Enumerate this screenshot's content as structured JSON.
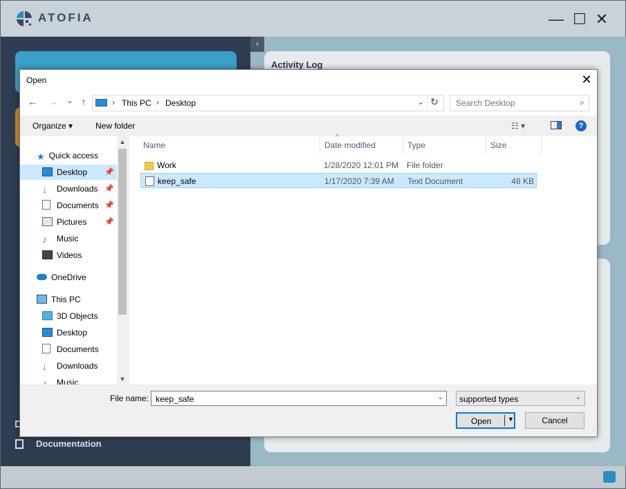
{
  "app": {
    "brand": "ATOFIA",
    "minimize": "—",
    "maximize": "☐",
    "close": "✕",
    "collapse": "‹",
    "activity_title": "Activity Log",
    "documentation_label": "Documentation"
  },
  "dialog": {
    "title": "Open",
    "close": "✕",
    "nav": {
      "back": "←",
      "forward": "→",
      "recent": "⌄",
      "up": "↑"
    },
    "address": {
      "crumbs": [
        "This PC",
        "Desktop"
      ],
      "separator": "›",
      "dropdown": "⌄",
      "refresh": "↻"
    },
    "search_placeholder": "Search Desktop",
    "search_icon": "⌕",
    "toolbar": {
      "organize": "Organize ▾",
      "new_folder": "New folder",
      "view": "☷ ▾",
      "help": "?"
    },
    "nav_pane": {
      "quick_access": "Quick access",
      "quick_items": [
        {
          "label": "Desktop",
          "icon": "desktop-icon",
          "pinned": true
        },
        {
          "label": "Downloads",
          "icon": "downloads-icon",
          "pinned": true
        },
        {
          "label": "Documents",
          "icon": "documents-icon",
          "pinned": true
        },
        {
          "label": "Pictures",
          "icon": "pictures-icon",
          "pinned": true
        },
        {
          "label": "Music",
          "icon": "music-icon",
          "pinned": false
        },
        {
          "label": "Videos",
          "icon": "videos-icon",
          "pinned": false
        }
      ],
      "onedrive": "OneDrive",
      "this_pc": "This PC",
      "pc_items": [
        "3D Objects",
        "Desktop",
        "Documents",
        "Downloads",
        "Music"
      ],
      "pin_glyph": "📌",
      "scroll_up": "▲",
      "scroll_down": "▼"
    },
    "columns": [
      "Name",
      "Date modified",
      "Type",
      "Size"
    ],
    "sort_indicator": "^",
    "files": [
      {
        "name": "Work",
        "date": "1/28/2020 12:01 PM",
        "type": "File folder",
        "size": "",
        "icon": "folder-icon"
      },
      {
        "name": "keep_safe",
        "date": "1/17/2020 7:39 AM",
        "type": "Text Document",
        "size": "48 KB",
        "icon": "text-file-icon"
      }
    ],
    "filename_label": "File name:",
    "filename_value": "keep_safe",
    "filetype_value": "supported types",
    "open_label": "Open",
    "cancel_label": "Cancel",
    "dropdown_arrow": "⌄",
    "open_arrow": "▼",
    "grip": "⋰"
  },
  "colors": {
    "selection": "#cce8ff",
    "accent": "#0078d7",
    "app_sidebar": "#2f3d52",
    "app_accent": "#3aa0c8"
  }
}
